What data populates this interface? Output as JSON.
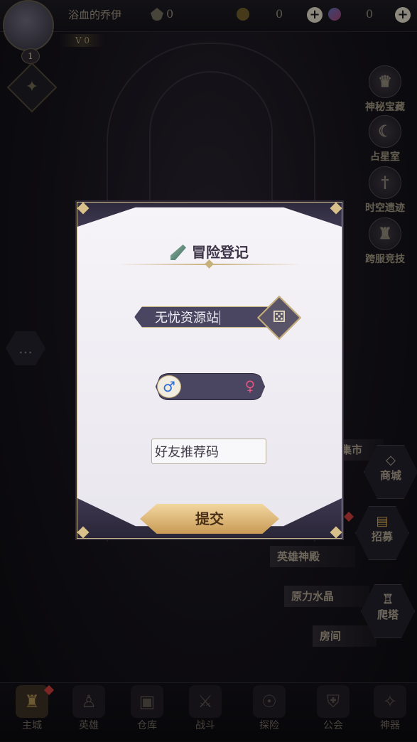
{
  "player": {
    "name": "浴血的乔伊",
    "level": "1",
    "vip": "V 0"
  },
  "resources": [
    {
      "icon": "gem-icon",
      "value": "0"
    },
    {
      "icon": "coin-icon",
      "value": "0"
    },
    {
      "icon": "crystal-icon",
      "value": "0"
    }
  ],
  "side_menu": {
    "items": [
      {
        "label": "神秘宝藏",
        "icon": "treasure-icon"
      },
      {
        "label": "占星室",
        "icon": "moon-icon"
      },
      {
        "label": "时空遗迹",
        "icon": "sword-icon"
      },
      {
        "label": "跨服竞技",
        "icon": "crown-icon"
      }
    ]
  },
  "town": {
    "market": "集市",
    "shop": "商城",
    "recruit": "招募",
    "hero_temple": "英雄神殿",
    "force_crystal": "原力水晶",
    "room": "房间",
    "tower": "爬塔"
  },
  "bottom_nav": [
    {
      "label": "主城",
      "icon": "castle-icon",
      "active": true
    },
    {
      "label": "英雄",
      "icon": "hero-icon"
    },
    {
      "label": "仓库",
      "icon": "storage-icon"
    },
    {
      "label": "战斗",
      "icon": "battle-icon"
    },
    {
      "label": "探险",
      "icon": "explore-icon"
    },
    {
      "label": "公会",
      "icon": "guild-icon"
    },
    {
      "label": "神器",
      "icon": "artifact-icon"
    }
  ],
  "dialog": {
    "title": "冒险登记",
    "name_value": "无忧资源站",
    "male_symbol": "♂",
    "female_symbol": "♀",
    "referral_placeholder": "好友推荐码",
    "submit_label": "提交"
  }
}
